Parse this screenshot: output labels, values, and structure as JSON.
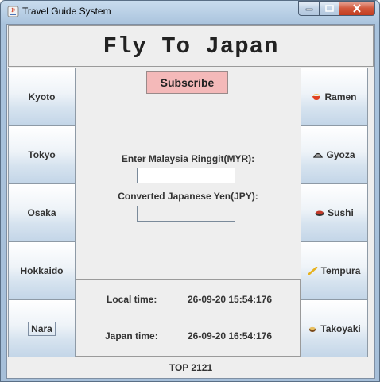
{
  "window": {
    "title": "Travel Guide System"
  },
  "header": {
    "title": "Fly To Japan"
  },
  "left_nav": [
    {
      "label": "Kyoto"
    },
    {
      "label": "Tokyo"
    },
    {
      "label": "Osaka"
    },
    {
      "label": "Hokkaido"
    },
    {
      "label": "Nara"
    }
  ],
  "right_nav": [
    {
      "label": "Ramen",
      "icon": "ramen-icon"
    },
    {
      "label": "Gyoza",
      "icon": "gyoza-icon"
    },
    {
      "label": "Sushi",
      "icon": "sushi-icon"
    },
    {
      "label": "Tempura",
      "icon": "tempura-icon"
    },
    {
      "label": "Takoyaki",
      "icon": "takoyaki-icon"
    }
  ],
  "converter": {
    "subscribe_label": "Subscribe",
    "myr_label": "Enter Malaysia Ringgit(MYR):",
    "myr_value": "",
    "jpy_label": "Converted Japanese Yen(JPY):",
    "jpy_value": ""
  },
  "time": {
    "local_label": "Local time:",
    "local_value": "26-09-20 15:54:176",
    "japan_label": "Japan time:",
    "japan_value": "26-09-20 16:54:176"
  },
  "footer": {
    "text": "TOP 2121"
  },
  "colors": {
    "subscribe_bg": "#f4b9b9",
    "panel_bg": "#eeeeee",
    "close_button": "#c94a2e"
  }
}
